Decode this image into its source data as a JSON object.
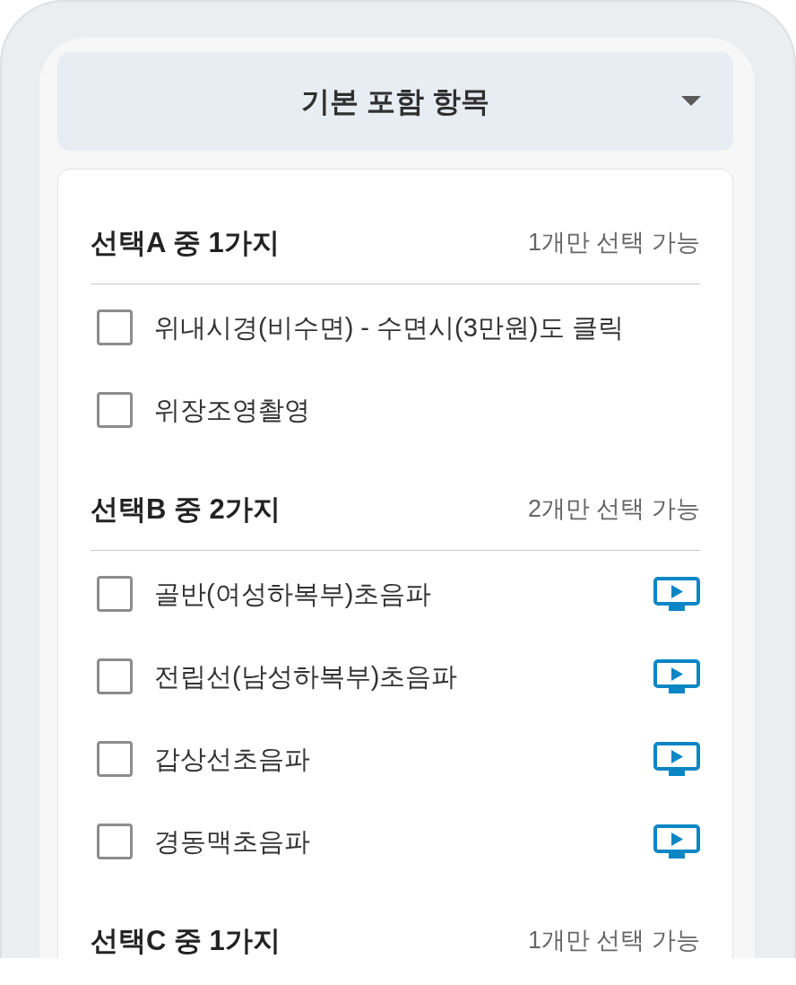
{
  "header": {
    "title": "기본 포함 항목"
  },
  "sections": [
    {
      "title": "선택A 중 1가지",
      "limit_note": "1개만 선택 가능",
      "items": [
        {
          "label": "위내시경(비수면) - 수면시(3만원)도 클릭",
          "checked": false,
          "video": false
        },
        {
          "label": "위장조영촬영",
          "checked": false,
          "video": false
        }
      ]
    },
    {
      "title": "선택B 중 2가지",
      "limit_note": "2개만 선택 가능",
      "items": [
        {
          "label": "골반(여성하복부)초음파",
          "checked": false,
          "video": true
        },
        {
          "label": "전립선(남성하복부)초음파",
          "checked": false,
          "video": true
        },
        {
          "label": "갑상선초음파",
          "checked": false,
          "video": true
        },
        {
          "label": "경동맥초음파",
          "checked": false,
          "video": true
        }
      ]
    },
    {
      "title": "선택C 중 1가지",
      "limit_note": "1개만 선택 가능"
    }
  ]
}
